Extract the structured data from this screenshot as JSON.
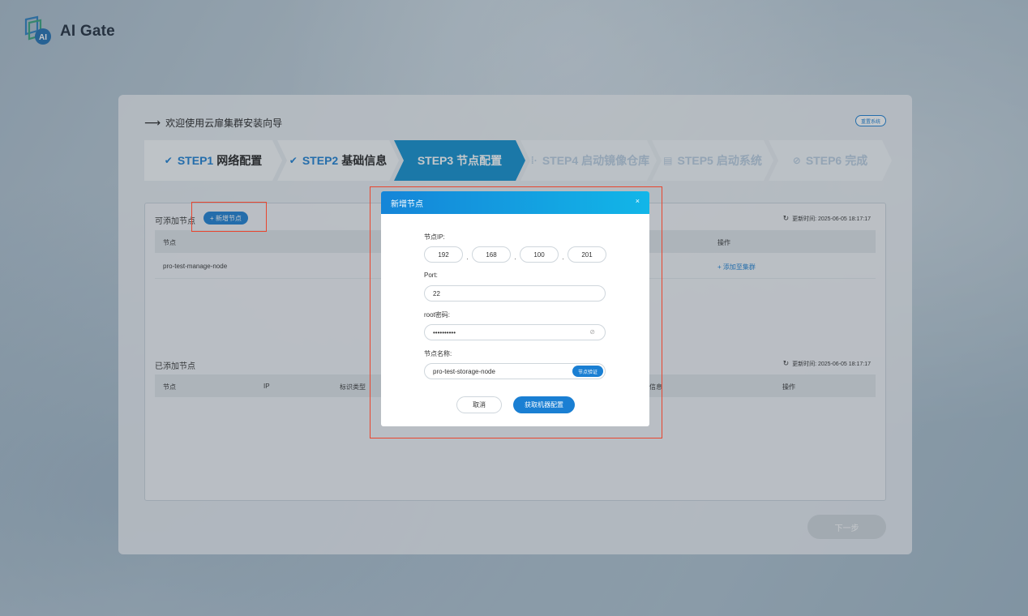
{
  "brand": {
    "name": "AI Gate",
    "mark_letter": "AI"
  },
  "wizard": {
    "title": "欢迎使用云扉集群安装向导",
    "reset_label": "重置系统",
    "steps": [
      {
        "num": "STEP1",
        "name": "网络配置",
        "state": "done"
      },
      {
        "num": "STEP2",
        "name": "基础信息",
        "state": "done"
      },
      {
        "num": "STEP3",
        "name": "节点配置",
        "state": "active"
      },
      {
        "num": "STEP4",
        "name": "启动镜像仓库",
        "state": "pending"
      },
      {
        "num": "STEP5",
        "name": "启动系统",
        "state": "pending"
      },
      {
        "num": "STEP6",
        "name": "完成",
        "state": "pending"
      }
    ],
    "next_label": "下一步"
  },
  "available": {
    "label": "可添加节点",
    "add_label": "+ 新增节点",
    "refresh": "更新时间: 2025-06-05 18:17:17",
    "columns": {
      "node": "节点",
      "action": "操作"
    },
    "rows": [
      {
        "node": "pro-test-manage-node",
        "action": "+ 添加至集群"
      }
    ]
  },
  "added": {
    "label": "已添加节点",
    "refresh": "更新时间: 2025-06-05 18:17:17",
    "columns": {
      "node": "节点",
      "ip": "IP",
      "tag_type": "标识类型",
      "info": "信息",
      "action": "操作"
    }
  },
  "modal": {
    "title": "新增节点",
    "close": "×",
    "ip_label": "节点IP:",
    "ip": [
      "192",
      "168",
      "100",
      "201"
    ],
    "port_label": "Port:",
    "port": "22",
    "password_label": "root密码:",
    "password": "••••••••••",
    "name_label": "节点名称:",
    "name": "pro-test-storage-node",
    "verify_label": "节点验证",
    "cancel_label": "取消",
    "submit_label": "获取机器配置"
  },
  "colors": {
    "accent": "#1a7fd3",
    "highlight": "#e8462f",
    "step_active": "#0e8fcf"
  }
}
